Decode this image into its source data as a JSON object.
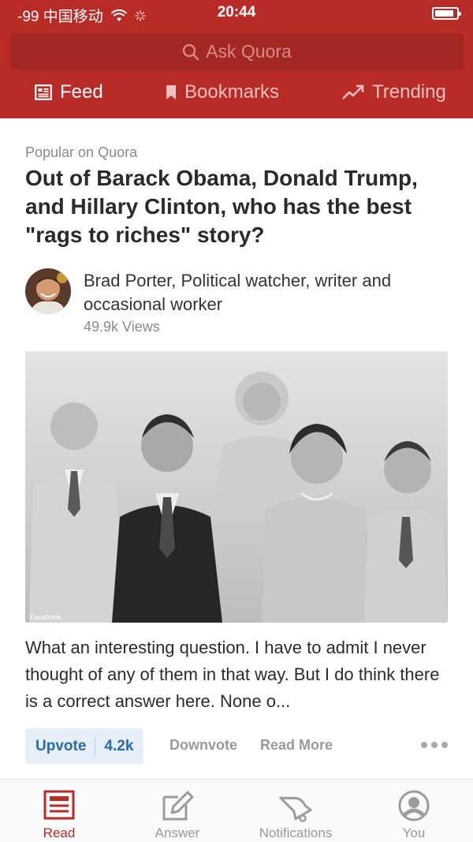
{
  "status": {
    "signal": "-99 中国移动",
    "time": "20:44",
    "battery": 0.9
  },
  "search": {
    "placeholder": "Ask Quora"
  },
  "tabs": [
    {
      "label": "Feed",
      "icon": "feed-icon",
      "active": true
    },
    {
      "label": "Bookmarks",
      "icon": "bookmark-icon",
      "active": false
    },
    {
      "label": "Trending",
      "icon": "trending-icon",
      "active": false
    }
  ],
  "story": {
    "kicker": "Popular on Quora",
    "title": "Out of Barack Obama, Donald Trump, and Hillary Clinton, who has the best \"rags to riches\" story?",
    "author": "Brad Porter, Political watcher, writer and occasional worker",
    "views": "49.9k Views",
    "image_credit": "Facebook",
    "excerpt": "What an interesting question. I have to admit I never thought of any of them in that way. But I do think there is a correct answer here. None o..."
  },
  "actions": {
    "upvote": "Upvote",
    "upvote_count": "4.2k",
    "downvote": "Downvote",
    "read_more": "Read More"
  },
  "bottom_nav": [
    {
      "label": "Read",
      "icon": "read-icon",
      "active": true
    },
    {
      "label": "Answer",
      "icon": "answer-icon",
      "active": false
    },
    {
      "label": "Notifications",
      "icon": "bell-icon",
      "active": false
    },
    {
      "label": "You",
      "icon": "profile-icon",
      "active": false
    }
  ],
  "colors": {
    "brand": "#b92b27",
    "upvote_blue": "#2e69a8"
  }
}
